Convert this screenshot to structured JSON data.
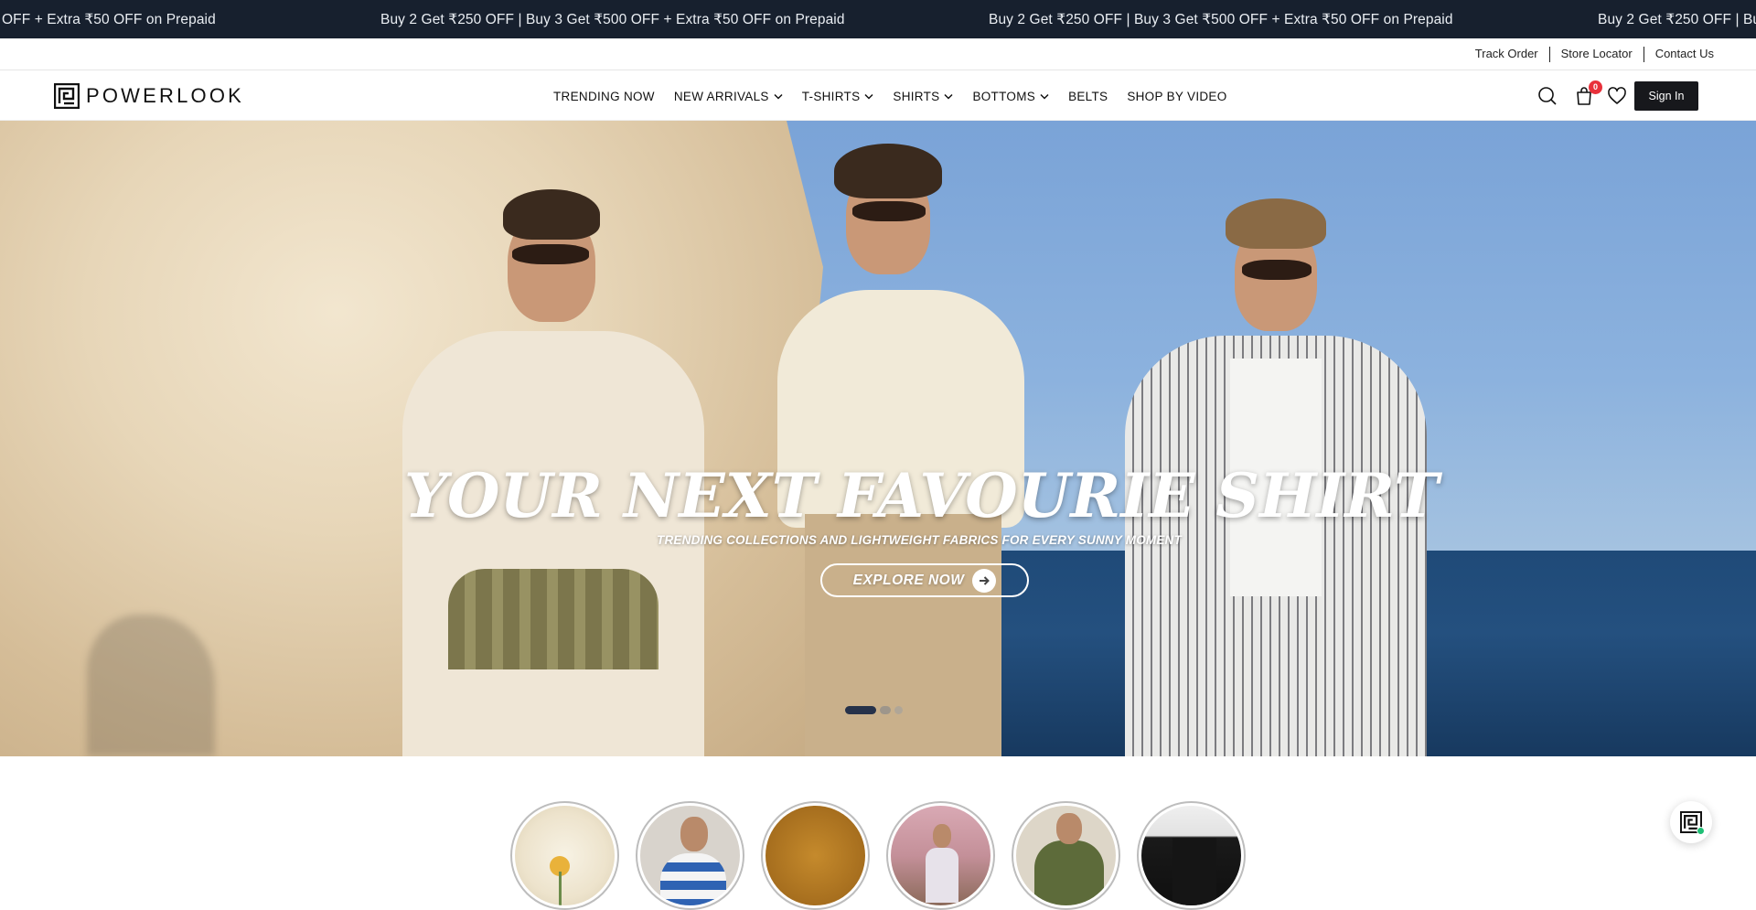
{
  "announcement": {
    "messages": [
      "OFF + Extra ₹50 OFF on Prepaid",
      "Buy 2 Get ₹250 OFF | Buy 3 Get ₹500 OFF + Extra ₹50 OFF on Prepaid",
      "Buy 2 Get ₹250 OFF | Buy 3 Get ₹500 OFF + Extra ₹50 OFF on Prepaid",
      "Buy 2 Get ₹250 OFF | Buy"
    ]
  },
  "utility": {
    "track_order": "Track Order",
    "store_locator": "Store Locator",
    "contact_us": "Contact Us"
  },
  "header": {
    "logo_text": "POWERLOOK",
    "nav": {
      "trending": "TRENDING NOW",
      "new_arrivals": "NEW ARRIVALS",
      "tshirts": "T-SHIRTS",
      "shirts": "SHIRTS",
      "bottoms": "BOTTOMS",
      "belts": "BELTS",
      "shop_by_video": "SHOP BY VIDEO"
    },
    "cart_count": "0",
    "sign_in": "Sign In"
  },
  "hero": {
    "headline": "YOUR NEXT FAVOURIE SHIRT",
    "subheadline": "TRENDING COLLECTIONS AND LIGHTWEIGHT FABRICS FOR EVERY SUNNY MOMENT",
    "cta": "EXPLORE NOW",
    "slide_count": "3",
    "active_slide": "1"
  },
  "colors": {
    "announcement_bg": "#17202e",
    "cart_badge": "#e8313b",
    "sign_in_bg": "#17181c",
    "online_dot": "#1fbf75"
  }
}
